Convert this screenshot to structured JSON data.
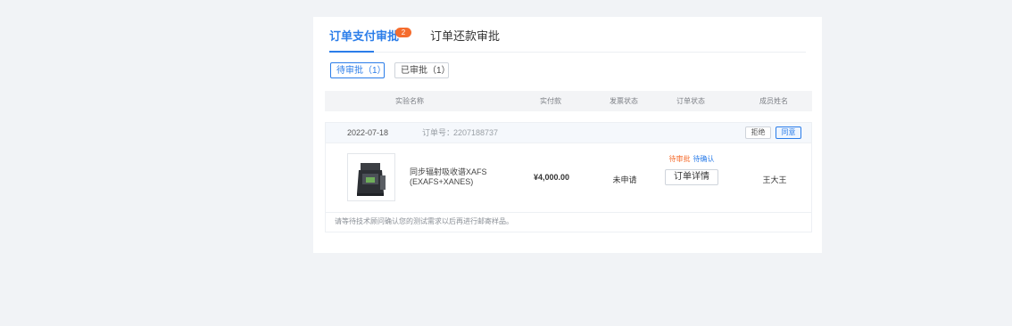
{
  "tabs": [
    {
      "label": "订单支付审批",
      "badge": "2",
      "active": true
    },
    {
      "label": "订单还款审批",
      "active": false
    }
  ],
  "filters": [
    {
      "label": "待审批（1）",
      "active": true
    },
    {
      "label": "已审批（1）",
      "active": false
    }
  ],
  "table": {
    "headers": [
      "实验名称",
      "实付款",
      "发票状态",
      "订单状态",
      "成员姓名"
    ]
  },
  "order": {
    "date": "2022-07-18",
    "order_no_label": "订单号：",
    "order_no": "2207188737",
    "reject_label": "拒绝",
    "agree_label": "同意",
    "experiment_name": "同步辐射吸收谱XAFS (EXAFS+XANES)",
    "amount": "¥4,000.00",
    "invoice_status": "未申请",
    "status_pending": "待审批",
    "status_confirm": "待确认",
    "detail_label": "订单详情",
    "member_name": "王大王",
    "footer_note": "请等待技术顾问确认您的测试需求以后再进行邮寄样品。"
  },
  "colors": {
    "accent": "#2b7de9",
    "badge": "#f56c2d",
    "pending_status": "#f56c2d",
    "background": "#f1f3f6"
  },
  "icons": {
    "product_thumbnail": "instrument-image"
  }
}
